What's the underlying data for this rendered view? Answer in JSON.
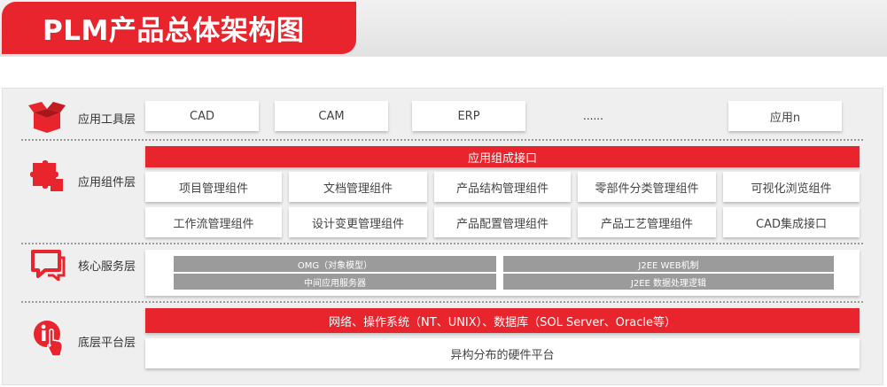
{
  "title": "PLM产品总体架构图",
  "colors": {
    "accent": "#e8242c",
    "gray_bar": "#9b9b9b",
    "panel": "#efefef"
  },
  "layers": {
    "tools": {
      "label": "应用工具层",
      "icon": "open-box-icon",
      "items": [
        "CAD",
        "CAM",
        "ERP",
        "......",
        "应用n"
      ]
    },
    "components": {
      "label": "应用组件层",
      "icon": "puzzle-icon",
      "interface_bar": "应用组成接口",
      "row1": [
        "项目管理组件",
        "文档管理组件",
        "产品结构管理组件",
        "零部件分类管理组件",
        "可视化浏览组件"
      ],
      "row2": [
        "工作流管理组件",
        "设计变更管理组件",
        "产品配置管理组件",
        "产品工艺管理组件",
        "CAD集成接口"
      ]
    },
    "core": {
      "label": "核心服务层",
      "icon": "chat-bubble-icon",
      "bars": [
        "OMG（对象模型）",
        "J2EE WEB机制",
        "中间应用服务器",
        "J2EE 数据处理逻辑"
      ]
    },
    "platform": {
      "label": "底层平台层",
      "icon": "info-hand-icon",
      "red_bar": "网络、操作系统（NT、UNIX）、数据库（SOL Server、Oracle等）",
      "hardware": "异构分布的硬件平台"
    }
  }
}
